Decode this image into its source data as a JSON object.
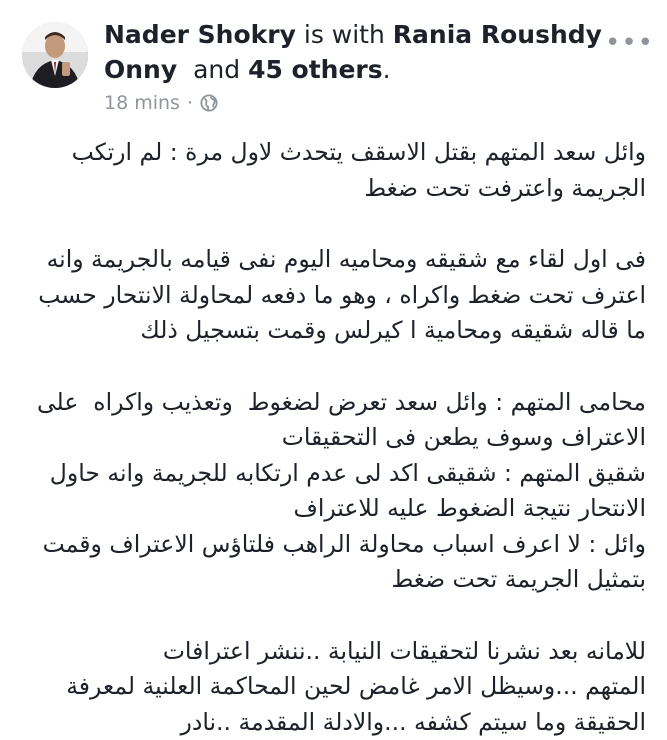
{
  "header": {
    "author": "Nader Shokry",
    "with_text": "is with",
    "tagged_name_part1": "Rania Roushdy",
    "tagged_name_part2": "Onny",
    "and_text": "and",
    "others": "45 others",
    "period": "."
  },
  "meta": {
    "time": "18 mins",
    "separator": "·",
    "privacy_icon": "globe-icon"
  },
  "menu_icon": "more-options-icon",
  "post": {
    "paragraphs": [
      [
        "وائل سعد المتهم بقتل الاسقف يتحدث لاول مرة : لم ارتكب",
        "الجريمة واعترفت تحت ضغط"
      ],
      [
        "فى اول لقاء مع شقيقه ومحاميه اليوم نفى قيامه بالجريمة وانه",
        "اعترف تحت ضغط واكراه ، وهو ما دفعه لمحاولة الانتحار حسب",
        "ما قاله شقيقه ومحامية ا كيرلس وقمت بتسجيل ذلك"
      ],
      [
        "محامى المتهم : وائل سعد تعرض لضغوط  وتعذيب واكراه  على",
        "الاعتراف وسوف يطعن فى التحقيقات",
        "شقيق المتهم : شقيقى اكد لى عدم ارتكابه للجريمة وانه حاول",
        "الانتحار نتيجة الضغوط عليه للاعتراف",
        "وائل : لا اعرف اسباب محاولة الراهب فلتاؤس الاعتراف وقمت",
        "بتمثيل الجريمة تحت ضغط"
      ],
      [
        "للامانه بعد نشرنا لتحقيقات النيابة ..ننشر اعترافات",
        "المتهم ...وسيظل الامر غامض لحين المحاكمة العلنية لمعرفة",
        "الحقيقة وما سيتم كشفه ...والادلة المقدمة ..نادر"
      ]
    ]
  }
}
